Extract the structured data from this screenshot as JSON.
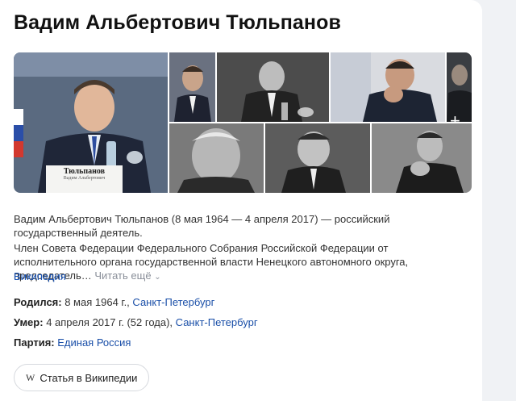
{
  "entity": {
    "title": "Вадим Альбертович Тюльпанов"
  },
  "gallery": {
    "nameplate_line1": "Тюльпанов",
    "nameplate_line2": "Вадим Альбертович",
    "more_glyph": "+"
  },
  "summary": {
    "text": "Вадим Альбертович Тюльпанов (8 мая 1964 — 4 апреля 2017) — российский государственный деятель."
  },
  "description": {
    "text": "Член Совета Федерации Федерального Собрания Российской Федерации от исполнительного органа государственной власти Ненецкого автономного округа, председатель…",
    "read_more": "Читать ещё",
    "source": "Википедия"
  },
  "facts": {
    "born": {
      "label": "Родился:",
      "value": "8 мая 1964 г.,",
      "place": "Санкт-Петербург"
    },
    "died": {
      "label": "Умер:",
      "value": "4 апреля 2017 г. (52 года),",
      "place": "Санкт-Петербург"
    },
    "party": {
      "label": "Партия:",
      "value": "Единая Россия"
    }
  },
  "wiki_button": {
    "icon": "W",
    "label": "Статья в Википедии"
  }
}
